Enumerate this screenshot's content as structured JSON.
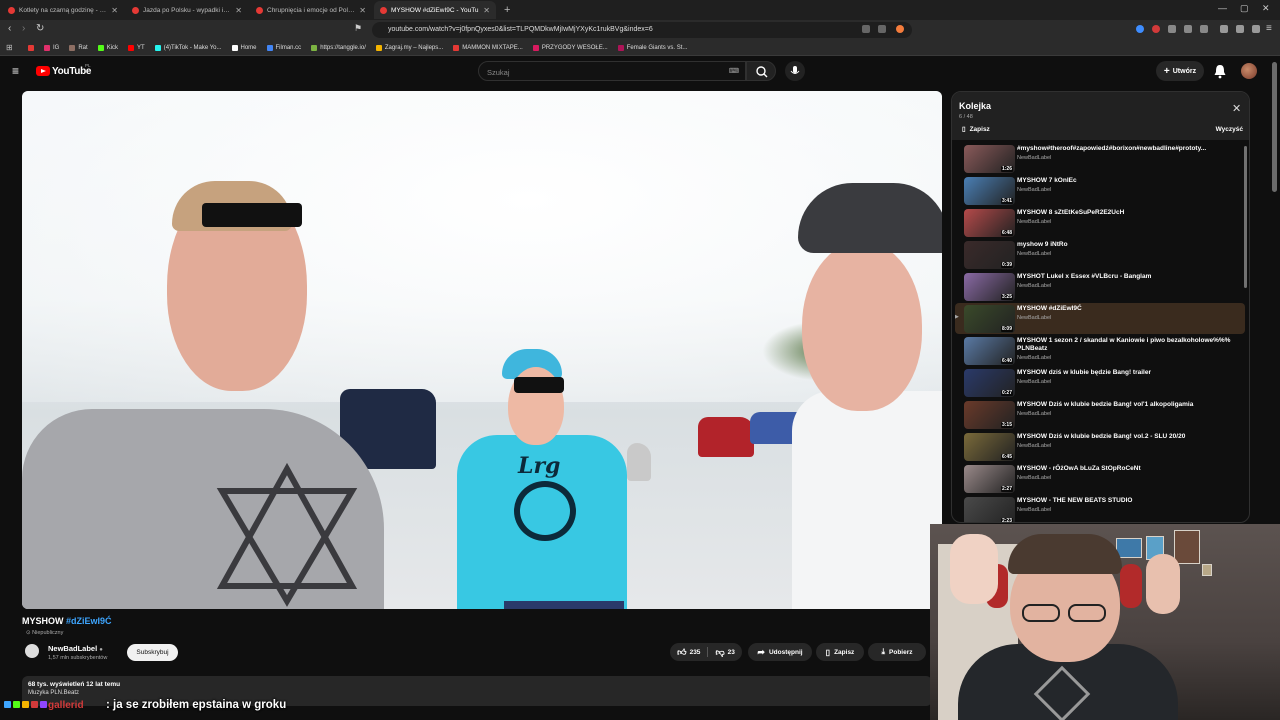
{
  "browser": {
    "tabs": [
      {
        "label": "Kotlety na czarną godzinę - mogą st",
        "active": false
      },
      {
        "label": "Jazda po Polsku - wypadki i kolizje o",
        "active": false
      },
      {
        "label": "Chrupnięcia i emocje od Poliny😄 -",
        "active": false
      },
      {
        "label": "MYSHOW #dZiEwI9Ć - YouTu",
        "active": true
      }
    ],
    "new_tab": "+",
    "window_controls": [
      "—",
      "▢",
      "✕"
    ],
    "url": "youtube.com/watch?v=j0fpnQyxes0&list=TLPQMDkwMjIwMjYXyKc1rukBVg&index=6",
    "bookmarks": [
      "IG",
      "Rat",
      "Kick",
      "YT",
      "(4)TikTok - Make Yo...",
      "Home",
      "Filman.cc",
      "https://tanggle.io/",
      "Zagraj.my – Najleps...",
      "MAMMON MIXTAPE...",
      "PRZYGODY WESOŁE...",
      "Female Giants vs. St..."
    ],
    "bookmark_colors": [
      "#e53935",
      "#e1306c",
      "#8d6e63",
      "#53fc18",
      "#ff0000",
      "#25f4ee",
      "#ffffff",
      "#4285f4",
      "#7cb342",
      "#f4b400",
      "#e53935",
      "#d81b60",
      "#ad1457"
    ]
  },
  "youtube": {
    "logo": "YouTube",
    "logo_region": "PL",
    "search_placeholder": "Szukaj",
    "create_label": "Utwórz",
    "video": {
      "title_main": "MYSHOW",
      "title_tag": "#dZiEwI9Ć",
      "privacy": "Niepubliczny",
      "channel": "NewBadLabel",
      "subscribers": "1,57 mln subskrybentów",
      "subscribe_label": "Subskrybuj",
      "likes": "235",
      "dislikes": "23",
      "share_label": "Udostępnij",
      "save_label": "Zapisz",
      "download_label": "Pobierz",
      "views_date": "68 tys. wyświetleń  12 lat temu",
      "desc_line": "Muzyka PLN.Beatz"
    },
    "queue": {
      "title": "Kolejka",
      "position": "6 / 48",
      "save_label": "Zapisz",
      "clear_label": "Wyczyść",
      "items": [
        {
          "title": "#myshow#theroof#zapowiedź#borixon#newbadline#prototy...",
          "channel": "NewBadLabel",
          "duration": "1:26",
          "active": false,
          "thumb": "#8a5a5a"
        },
        {
          "title": "MYSHOW 7 kOnIEc",
          "channel": "NewBadLabel",
          "duration": "3:41",
          "active": false,
          "thumb": "#4a7fb5"
        },
        {
          "title": "MYSHOW 8 sZtEtKeSuPeR2E2UcH",
          "channel": "NewBadLabel",
          "duration": "6:48",
          "active": false,
          "thumb": "#b54a4a"
        },
        {
          "title": "myshow 9 iNtRo",
          "channel": "NewBadLabel",
          "duration": "0:39",
          "active": false,
          "thumb": "#3a2a2a"
        },
        {
          "title": "MYSHOT Lukel x Essex #VLBcru - Banglam",
          "channel": "NewBadLabel",
          "duration": "3:25",
          "active": false,
          "thumb": "#8a6aa5"
        },
        {
          "title": "MYSHOW #dZiEwI9Ć",
          "channel": "NewBadLabel",
          "duration": "8:09",
          "active": true,
          "thumb": "#3a4a2a"
        },
        {
          "title": "MYSHOW 1 sezon 2 / skandal w Kaniowie i piwo bezalkoholowe%%% PLNBeatz",
          "channel": "NewBadLabel",
          "duration": "6:40",
          "active": false,
          "thumb": "#5a7aa5"
        },
        {
          "title": "MYSHOW dziś w klubie będzie Bang! trailer",
          "channel": "NewBadLabel",
          "duration": "0:27",
          "active": false,
          "thumb": "#2a3a6a"
        },
        {
          "title": "MYSHOW Dziś w klubie bedzie Bang! vol'1 alkopoligamia",
          "channel": "NewBadLabel",
          "duration": "3:15",
          "active": false,
          "thumb": "#6a3a2a"
        },
        {
          "title": "MYSHOW Dziś w klubie bedzie Bang! vol.2 - SLU 20/20",
          "channel": "NewBadLabel",
          "duration": "6:45",
          "active": false,
          "thumb": "#7a6a3a"
        },
        {
          "title": "MYSHOW - rÓżOwA bLuZa StOpRoCeNt",
          "channel": "NewBadLabel",
          "duration": "2:27",
          "active": false,
          "thumb": "#9a8a8a"
        },
        {
          "title": "MYSHOW - THE NEW BEATS STUDIO",
          "channel": "NewBadLabel",
          "duration": "2:23",
          "active": false,
          "thumb": "#4a4a4a"
        }
      ]
    }
  },
  "chat": {
    "username": "gallerid",
    "message": ": ja se zrobiłem epstaina w groku",
    "badge_colors": [
      "#3ea6ff",
      "#53fc18",
      "#f4b400",
      "#d23a3a",
      "#9146ff"
    ]
  }
}
